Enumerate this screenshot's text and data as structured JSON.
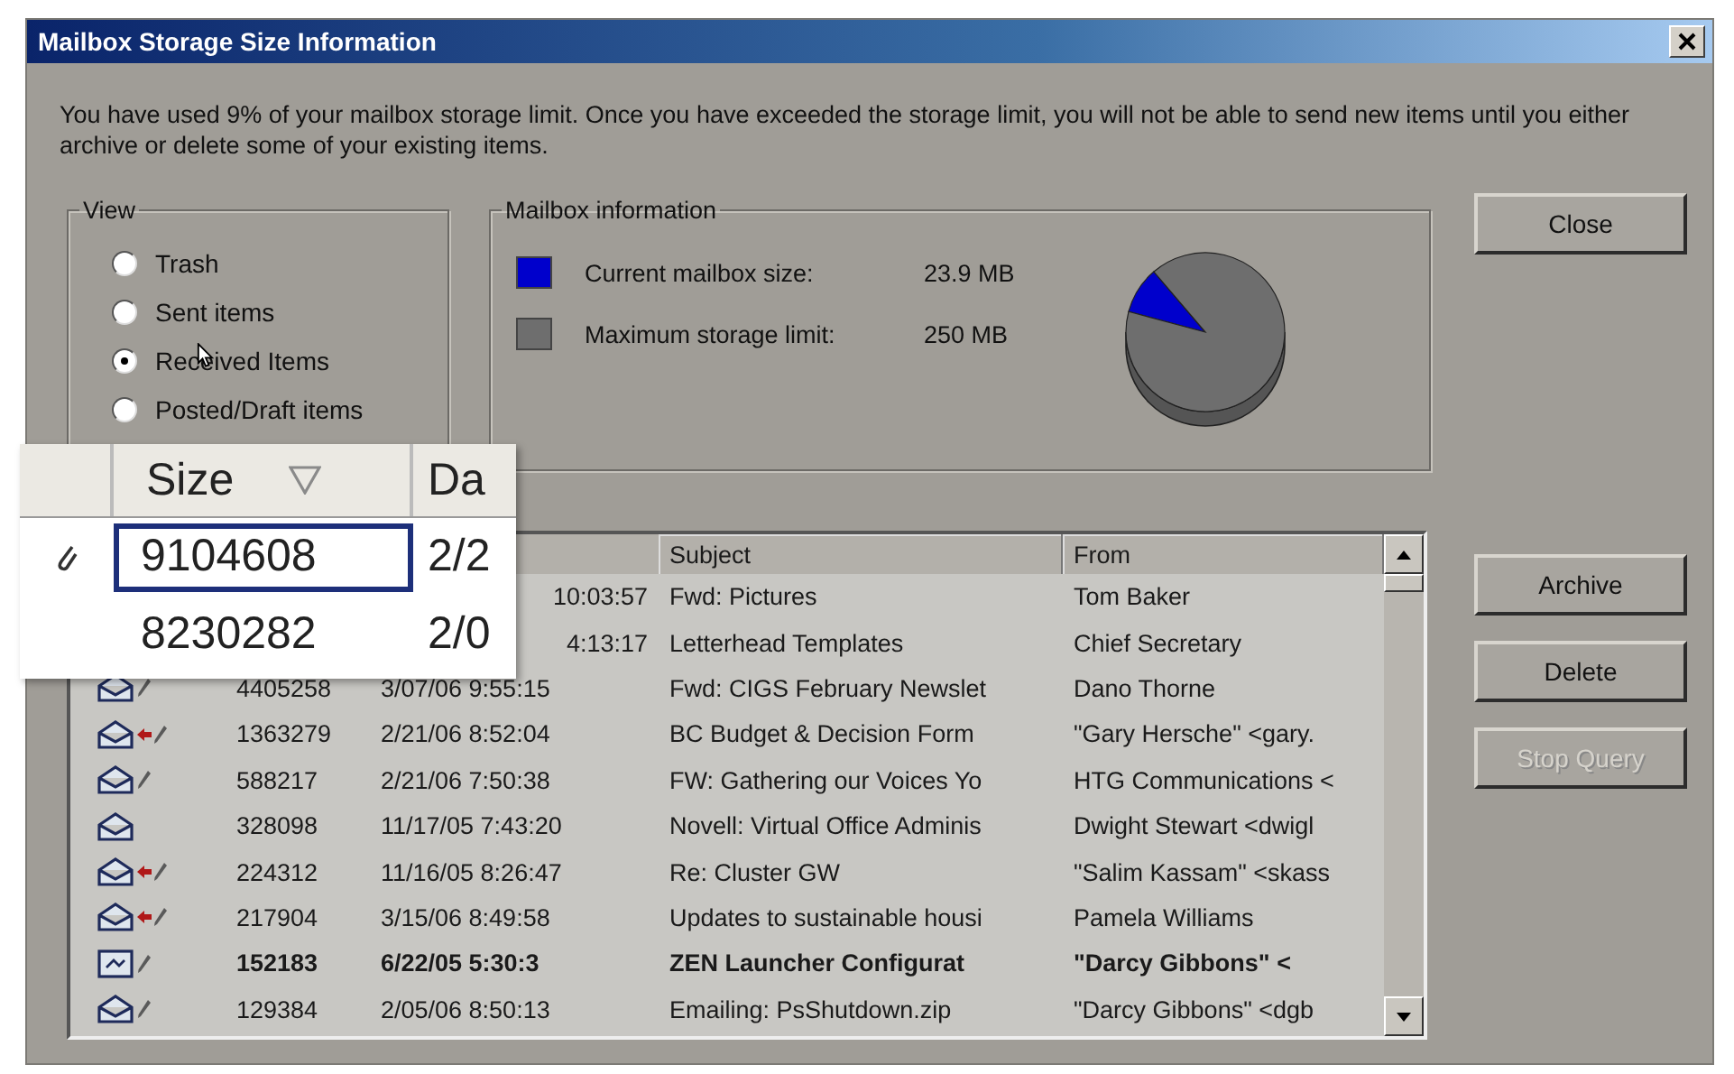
{
  "window": {
    "title": "Mailbox Storage Size Information"
  },
  "message": "You have used 9% of your mailbox storage limit.  Once you have exceeded the storage limit, you will not be able to send new items until you either archive or delete some of your existing items.",
  "view": {
    "title": "View",
    "options": [
      {
        "label": "Trash",
        "selected": false
      },
      {
        "label": "Sent items",
        "selected": false
      },
      {
        "label": "Received Items",
        "selected": true
      },
      {
        "label": "Posted/Draft items",
        "selected": false
      }
    ]
  },
  "mailbox_info": {
    "title": "Mailbox information",
    "legend": [
      {
        "label": "Current mailbox size:",
        "value": "23.9 MB",
        "color": "#0000cc"
      },
      {
        "label": "Maximum storage limit:",
        "value": "250 MB",
        "color": "#6e6e6e"
      }
    ],
    "chart_data": {
      "type": "pie",
      "values": [
        9.6,
        90.4
      ]
    }
  },
  "close_button": {
    "label": "Close"
  },
  "actions": [
    {
      "label": "Archive",
      "disabled": false
    },
    {
      "label": "Delete",
      "disabled": false
    },
    {
      "label": "Stop Query",
      "disabled": true
    }
  ],
  "table": {
    "columns": [
      "Subject",
      "From"
    ],
    "rows": [
      {
        "kind": "covered",
        "size": "",
        "date": "10:03:57",
        "subject": "Fwd: Pictures",
        "from": "Tom Baker",
        "unread": false
      },
      {
        "kind": "covered",
        "size": "",
        "date": "4:13:17",
        "subject": "Letterhead Templates",
        "from": "Chief Secretary",
        "unread": false
      },
      {
        "kind": "draft",
        "size": "4405258",
        "date": "3/07/06 9:55:15",
        "subject": "Fwd: CIGS February Newslet",
        "from": "Dano Thorne",
        "unread": false
      },
      {
        "kind": "replied",
        "size": "1363279",
        "date": "2/21/06 8:52:04",
        "subject": "BC Budget & Decision Form",
        "from": "\"Gary Hersche\" <gary.",
        "unread": false
      },
      {
        "kind": "draft",
        "size": "588217",
        "date": "2/21/06 7:50:38",
        "subject": "FW: Gathering our Voices Yo",
        "from": "HTG Communications <",
        "unread": false
      },
      {
        "kind": "opened",
        "size": "328098",
        "date": "11/17/05 7:43:20",
        "subject": "Novell: Virtual Office Adminis",
        "from": "Dwight Stewart <dwigl",
        "unread": false
      },
      {
        "kind": "replied",
        "size": "224312",
        "date": "11/16/05 8:26:47",
        "subject": "Re: Cluster GW",
        "from": "\"Salim Kassam\" <skass",
        "unread": false
      },
      {
        "kind": "replied",
        "size": "217904",
        "date": "3/15/06 8:49:58",
        "subject": "Updates to sustainable housi",
        "from": "Pamela Williams",
        "unread": false
      },
      {
        "kind": "note",
        "size": "152183",
        "date": "6/22/05 5:30:3",
        "subject": "ZEN Launcher Configurat",
        "from": "\"Darcy Gibbons\" <",
        "unread": true
      },
      {
        "kind": "draft",
        "size": "129384",
        "date": "2/05/06 8:50:13",
        "subject": "Emailing: PsShutdown.zip",
        "from": "\"Darcy Gibbons\" <dgb",
        "unread": false
      }
    ]
  },
  "magnifier": {
    "columns": [
      "Size",
      "Da"
    ],
    "rows": [
      {
        "attachment": true,
        "size": "9104608",
        "date": "2/2",
        "selected": true
      },
      {
        "attachment": false,
        "size": "8230282",
        "date": "2/0",
        "selected": false
      }
    ]
  }
}
